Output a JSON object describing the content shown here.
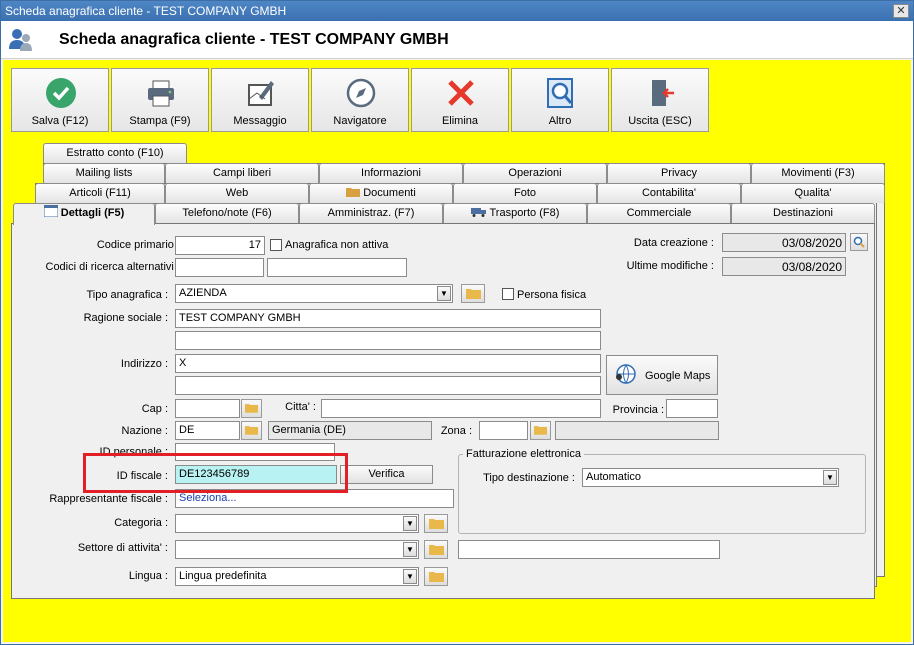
{
  "window": {
    "title": "Scheda anagrafica cliente - TEST COMPANY GMBH",
    "close": "✕"
  },
  "header": {
    "title": "Scheda anagrafica cliente - TEST COMPANY GMBH"
  },
  "toolbar": {
    "save": "Salva (F12)",
    "print": "Stampa (F9)",
    "message": "Messaggio",
    "navigator": "Navigatore",
    "delete": "Elimina",
    "other": "Altro",
    "exit": "Uscita (ESC)"
  },
  "tabs": {
    "row1": [
      "Estratto conto (F10)"
    ],
    "row2": [
      "Mailing lists",
      "Campi liberi",
      "Informazioni",
      "Operazioni",
      "Privacy",
      "Movimenti (F3)"
    ],
    "row3": [
      "Articoli (F11)",
      "Web",
      "Documenti",
      "Foto",
      "Contabilita'",
      "Qualita'"
    ],
    "row4": [
      "Dettagli (F5)",
      "Telefono/note (F6)",
      "Amministraz. (F7)",
      "Trasporto (F8)",
      "Commerciale",
      "Destinazioni"
    ]
  },
  "form": {
    "primary_code_label": "Codice primario :",
    "primary_code": "17",
    "inactive_label": "Anagrafica non attiva",
    "alt_codes_label": "Codici di ricerca alternativi :",
    "type_label": "Tipo anagrafica :",
    "type_value": "AZIENDA",
    "natural_person_label": "Persona fisica",
    "company_name_label": "Ragione sociale :",
    "company_name": "TEST COMPANY GMBH",
    "address_label": "Indirizzo :",
    "address": "X",
    "maps_button": "Google Maps",
    "zip_label": "Cap :",
    "city_label": "Citta' :",
    "province_label": "Provincia :",
    "country_label": "Nazione :",
    "country_code": "DE",
    "country_name": "Germania (DE)",
    "zone_label": "Zona :",
    "personal_id_label": "ID personale :",
    "tax_id_label": "ID fiscale :",
    "tax_id": "DE123456789",
    "verify_button": "Verifica",
    "tax_rep_label": "Rappresentante fiscale :",
    "tax_rep_value": "Seleziona...",
    "category_label": "Categoria :",
    "sector_label": "Settore di attivita' :",
    "language_label": "Lingua :",
    "language_value": "Lingua predefinita",
    "created_label": "Data creazione :",
    "created_value": "03/08/2020",
    "modified_label": "Ultime modifiche :",
    "modified_value": "03/08/2020",
    "einvoice_group": "Fatturazione elettronica",
    "dest_type_label": "Tipo destinazione :",
    "dest_type_value": "Automatico"
  },
  "colors": {
    "background": "#ffff00",
    "highlight": "#e21e26",
    "field_focus": "#b8f2f2",
    "titlebar": "#3a70b0"
  }
}
